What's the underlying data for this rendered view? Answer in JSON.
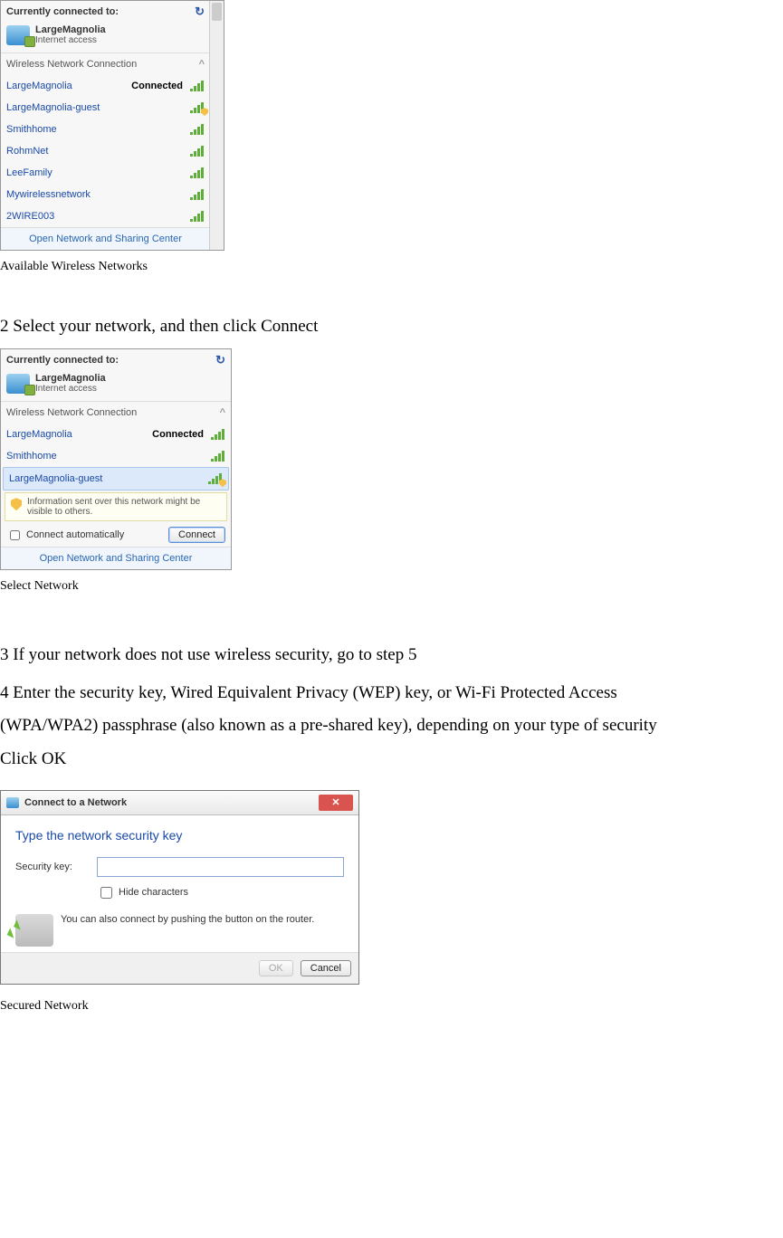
{
  "figure1": {
    "header": "Currently connected to:",
    "current": {
      "name": "LargeMagnolia",
      "sub": "Internet access"
    },
    "section": "Wireless Network Connection",
    "networks": [
      {
        "name": "LargeMagnolia",
        "status": "Connected",
        "shield": false
      },
      {
        "name": "LargeMagnolia-guest",
        "status": "",
        "shield": true
      },
      {
        "name": "Smithhome",
        "status": "",
        "shield": false
      },
      {
        "name": "RohmNet",
        "status": "",
        "shield": false
      },
      {
        "name": "LeeFamily",
        "status": "",
        "shield": false
      },
      {
        "name": "Mywirelessnetwork",
        "status": "",
        "shield": false
      },
      {
        "name": "2WIRE003",
        "status": "",
        "shield": false
      }
    ],
    "footer": "Open Network and Sharing Center",
    "caption": "Available Wireless Networks"
  },
  "step2": "2    Select your network, and then click Connect",
  "figure2": {
    "header": "Currently connected to:",
    "current": {
      "name": "LargeMagnolia",
      "sub": "Internet access"
    },
    "section": "Wireless Network Connection",
    "networks": [
      {
        "name": "LargeMagnolia",
        "status": "Connected",
        "shield": false
      },
      {
        "name": "Smithhome",
        "status": "",
        "shield": false
      },
      {
        "name": "LargeMagnolia-guest",
        "status": "",
        "shield": true,
        "selected": true
      }
    ],
    "info": "Information sent over this network might be visible to others.",
    "auto_label": "Connect automatically",
    "connect_btn": "Connect",
    "footer": "Open Network and Sharing Center",
    "caption": "Select Network"
  },
  "step3": "3    If   your   network does not use wireless security, go to step 5",
  "step4a": "4    Enter the security key, Wired Equivalent Privacy (WEP)  key, or Wi-Fi Protected Access",
  "step4b": "(WPA/WPA2) passphrase (also known as a pre-shared key), depending on your type of security",
  "step4c": "Click OK",
  "dialog": {
    "title": "Connect to a Network",
    "instruction": "Type the network security key",
    "field_label": "Security key:",
    "hide_label": "Hide characters",
    "hint": "You can also connect by pushing the button on the router.",
    "ok": "OK",
    "cancel": "Cancel",
    "caption": "Secured Network"
  }
}
